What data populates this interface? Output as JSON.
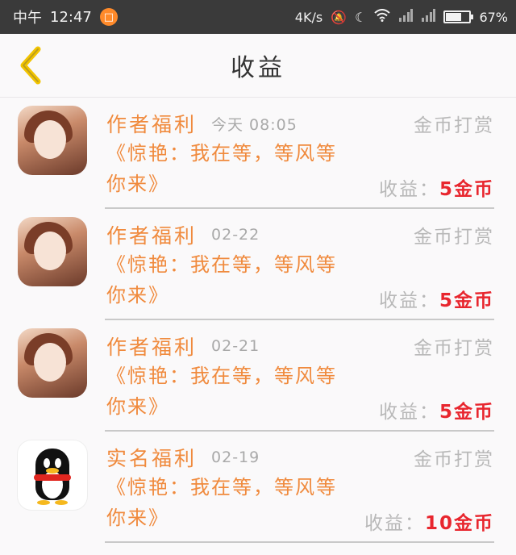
{
  "status_bar": {
    "carrier": "中午",
    "time": "12:47",
    "app_badge": "□",
    "speed": "4K/s",
    "battery_percent": "67%",
    "battery_level": 0.67
  },
  "header": {
    "title": "收益"
  },
  "items": [
    {
      "title": "作者福利",
      "time": "今天 08:05",
      "type": "金币打赏",
      "desc": "《惊艳：我在等，等风等你来》",
      "income_label": "收益：",
      "income_value": "5金币",
      "avatar": "girl"
    },
    {
      "title": "作者福利",
      "time": "02-22",
      "type": "金币打赏",
      "desc": "《惊艳：我在等，等风等你来》",
      "income_label": "收益：",
      "income_value": "5金币",
      "avatar": "girl"
    },
    {
      "title": "作者福利",
      "time": "02-21",
      "type": "金币打赏",
      "desc": "《惊艳：我在等，等风等你来》",
      "income_label": "收益：",
      "income_value": "5金币",
      "avatar": "girl"
    },
    {
      "title": "实名福利",
      "time": "02-19",
      "type": "金币打赏",
      "desc": "《惊艳：我在等，等风等你来》",
      "income_label": "收益：",
      "income_value": "10金币",
      "avatar": "qq-penguin"
    }
  ],
  "colors": {
    "accent": "#f08a3d",
    "income": "#e8262e",
    "muted": "#b8b8b8",
    "back_arrow": "#f2c400"
  }
}
